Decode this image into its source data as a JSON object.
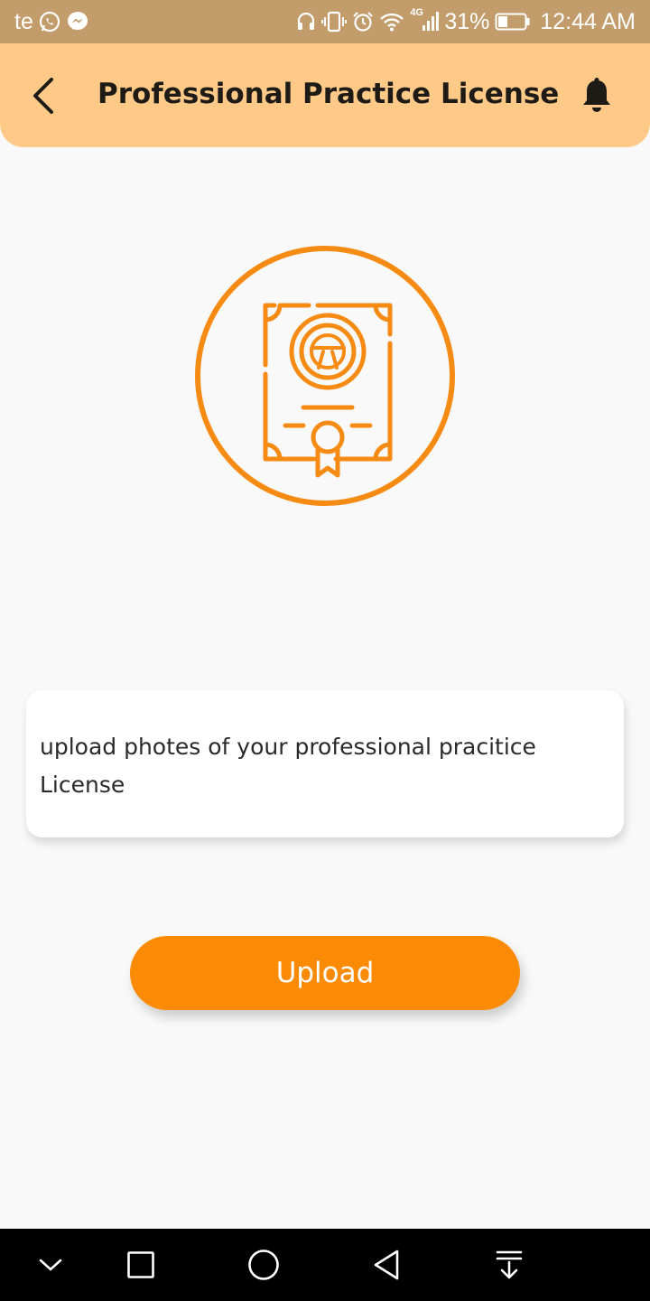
{
  "status_bar": {
    "carrier": "te",
    "network": "4G",
    "battery": "31%",
    "time": "12:44 AM",
    "left_icons": [
      "whatsapp-icon",
      "messenger-icon"
    ],
    "right_icons": [
      "headset-icon",
      "vibrate-icon",
      "alarm-icon",
      "wifi-icon",
      "signal-icon",
      "battery-icon"
    ]
  },
  "header": {
    "title": "Professional Practice License",
    "back_icon": "chevron-left-icon",
    "notification_icon": "bell-icon"
  },
  "illustration": {
    "icon": "license-certificate-icon",
    "accent_color": "#f68b14"
  },
  "info_card": {
    "text": "upload photes of your professional pracitice License"
  },
  "upload_button": {
    "label": "Upload",
    "color": "#fb8b05"
  },
  "nav_bar": {
    "icons": [
      "chevron-down-icon",
      "recents-square-icon",
      "home-circle-icon",
      "back-triangle-icon",
      "notification-pull-icon"
    ]
  },
  "colors": {
    "status_bar": "#c29d6b",
    "app_bar": "#ffca88",
    "background": "#f9f9f9",
    "accent": "#fb8b05"
  }
}
